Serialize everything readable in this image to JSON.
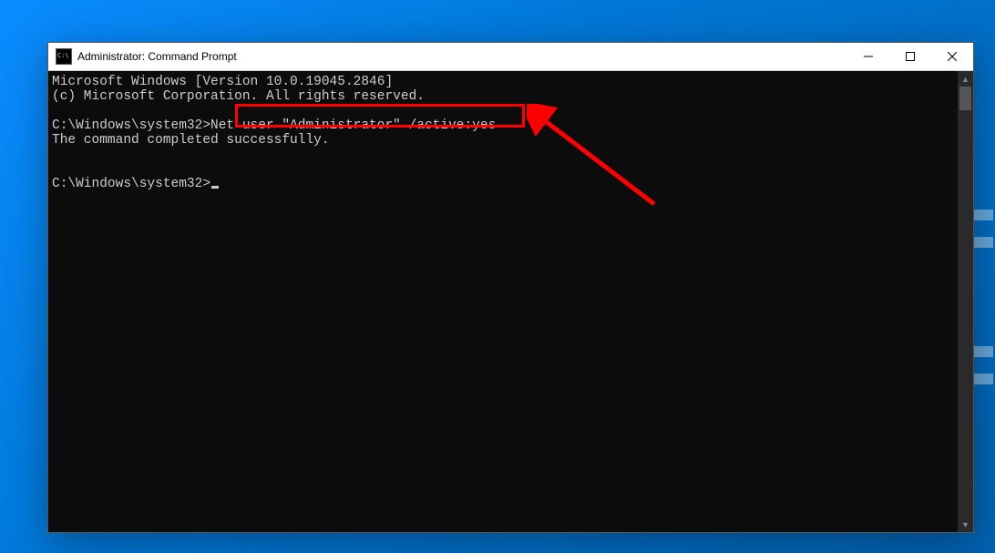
{
  "window": {
    "title": "Administrator: Command Prompt"
  },
  "console": {
    "line1": "Microsoft Windows [Version 10.0.19045.2846]",
    "line2": "(c) Microsoft Corporation. All rights reserved.",
    "prompt1_path": "C:\\Windows\\system32>",
    "command1": "Net user \"Administrator\" /active:yes",
    "result": "The command completed successfully.",
    "prompt2_path": "C:\\Windows\\system32>"
  }
}
